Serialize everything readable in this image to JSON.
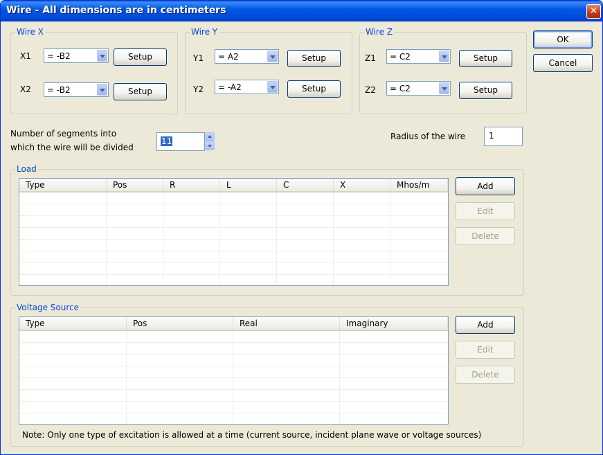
{
  "window": {
    "title": "Wire - All dimensions are in centimeters",
    "close_glyph": "✕"
  },
  "wire_x": {
    "legend": "Wire X",
    "rows": [
      {
        "label": "X1",
        "value": "= -B2",
        "setup": "Setup"
      },
      {
        "label": "X2",
        "value": "= -B2",
        "setup": "Setup"
      }
    ]
  },
  "wire_y": {
    "legend": "Wire Y",
    "rows": [
      {
        "label": "Y1",
        "value": "= A2",
        "setup": "Setup"
      },
      {
        "label": "Y2",
        "value": "= -A2",
        "setup": "Setup"
      }
    ]
  },
  "wire_z": {
    "legend": "Wire Z",
    "rows": [
      {
        "label": "Z1",
        "value": "= C2",
        "setup": "Setup"
      },
      {
        "label": "Z2",
        "value": "= C2",
        "setup": "Setup"
      }
    ]
  },
  "buttons": {
    "ok": "OK",
    "cancel": "Cancel"
  },
  "segments": {
    "label_line1": "Number of segments into",
    "label_line2": "which the wire will be divided",
    "value": "11"
  },
  "radius": {
    "label": "Radius of the wire",
    "value": "1"
  },
  "load": {
    "legend": "Load",
    "columns": [
      "Type",
      "Pos",
      "R",
      "L",
      "C",
      "X",
      "Mhos/m"
    ],
    "add": "Add",
    "edit": "Edit",
    "delete": "Delete"
  },
  "voltage_source": {
    "legend": "Voltage Source",
    "columns": [
      "Type",
      "Pos",
      "Real",
      "Imaginary"
    ],
    "add": "Add",
    "edit": "Edit",
    "delete": "Delete"
  },
  "note": "Note: Only one type of excitation is allowed at a time (current source, incident plane wave or voltage sources)",
  "colors": {
    "title_bar": "#0058e6",
    "group_legend": "#0046d5",
    "dialog_bg": "#ece9d8",
    "close_button": "#c5391b"
  }
}
